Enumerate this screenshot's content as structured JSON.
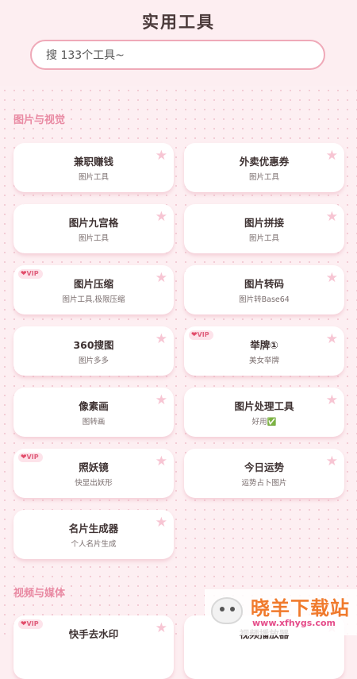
{
  "header": {
    "title": "实用工具"
  },
  "search": {
    "placeholder": "搜 133个工具~"
  },
  "sections": [
    {
      "title": "图片与视觉"
    },
    {
      "title": "视频与媒体"
    }
  ],
  "cards": [
    {
      "title": "兼职赚钱",
      "subtitle": "图片工具",
      "star": "★"
    },
    {
      "title": "外卖优惠券",
      "subtitle": "图片工具",
      "star": "★"
    },
    {
      "title": "图片九宫格",
      "subtitle": "图片工具",
      "star": "★"
    },
    {
      "title": "图片拼接",
      "subtitle": "图片工具",
      "star": "★"
    },
    {
      "title": "图片压缩",
      "subtitle": "图片工具,极限压缩",
      "star": "★",
      "vip": "VIP"
    },
    {
      "title": "图片转码",
      "subtitle": "图片转Base64",
      "star": "★"
    },
    {
      "title": "360搜图",
      "subtitle": "图片多多",
      "star": "★"
    },
    {
      "title": "举牌①",
      "subtitle": "美女举牌",
      "star": "★",
      "vip": "VIP"
    },
    {
      "title": "像素画",
      "subtitle": "图转画",
      "star": "★"
    },
    {
      "title": "图片处理工具",
      "subtitle": "好用✅",
      "star": "★"
    },
    {
      "title": "照妖镜",
      "subtitle": "快显出妖形",
      "star": "★",
      "vip": "VIP"
    },
    {
      "title": "今日运势",
      "subtitle": "运势占卜图片",
      "star": "★"
    },
    {
      "title": "名片生成器",
      "subtitle": "个人名片生成",
      "star": "★"
    },
    {
      "title": "快手去水印",
      "subtitle": "",
      "star": "★",
      "vip": "VIP"
    },
    {
      "title": "视频播放器",
      "subtitle": "",
      "star": "★"
    }
  ],
  "vip_heart": "❤",
  "watermark": {
    "text": "晓羊下载站",
    "url": "www.xfhygs.com"
  },
  "colors": {
    "background": "#fdeef1",
    "accent": "#e98aa3",
    "search_border": "#efa9b8",
    "star": "#f7c5d3",
    "vip": "#e0607d"
  }
}
